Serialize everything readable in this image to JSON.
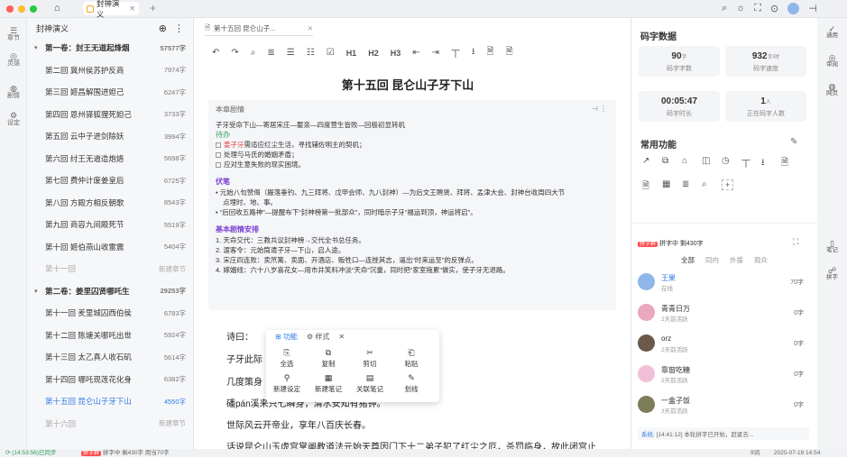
{
  "window": {
    "tab_label": "封神演义",
    "new_tab": "+"
  },
  "topbar_icons": [
    "search-icon",
    "sun-icon",
    "fullscreen-icon",
    "settings-icon",
    "avatar",
    "pin-icon"
  ],
  "leftbar": [
    {
      "label": "章节",
      "glyph": "☰"
    },
    {
      "label": "灵感",
      "glyph": "◎"
    },
    {
      "label": "剧情",
      "glyph": "◍"
    },
    {
      "label": "设定",
      "glyph": "⚙"
    }
  ],
  "outline": {
    "title": "封神演义",
    "add": "⊕",
    "more": "⋮",
    "rows": [
      {
        "name": "第一卷：封王无道起烽烟",
        "count": "57577字",
        "type": "vol"
      },
      {
        "name": "第二回 冀州侯苏护反商",
        "count": "7974字",
        "type": "ch"
      },
      {
        "name": "第三回 姬昌解围进妲己",
        "count": "6247字",
        "type": "ch"
      },
      {
        "name": "第四回 恩州驿狐狸死妲己",
        "count": "3733字",
        "type": "ch"
      },
      {
        "name": "第五回 云中子进剑除妖",
        "count": "3994字",
        "type": "ch"
      },
      {
        "name": "第六回 纣王无道造炮烙",
        "count": "5698字",
        "type": "ch"
      },
      {
        "name": "第七回 费仲计废姜皇后",
        "count": "6725字",
        "type": "ch"
      },
      {
        "name": "第八回 方殿方相反朝歌",
        "count": "8543字",
        "type": "ch"
      },
      {
        "name": "第九回 商容九间殿死节",
        "count": "5519字",
        "type": "ch"
      },
      {
        "name": "第十回 姬伯燕山收雷震",
        "count": "5404字",
        "type": "ch"
      },
      {
        "name": "第十一回",
        "count": "新建章节",
        "type": "new"
      },
      {
        "name": "第二卷：姜里囚贤哪吒生",
        "count": "29253字",
        "type": "vol"
      },
      {
        "name": "第十一回 羑里城囚西伯侯",
        "count": "6783字",
        "type": "ch"
      },
      {
        "name": "第十二回 陈塘关哪吒出世",
        "count": "5924字",
        "type": "ch"
      },
      {
        "name": "第十三回 太乙真人收石矶",
        "count": "5614字",
        "type": "ch"
      },
      {
        "name": "第十四回 哪吒现莲花化身",
        "count": "6382字",
        "type": "ch"
      },
      {
        "name": "第十五回 昆仑山子牙下山",
        "count": "4550字",
        "type": "cur"
      },
      {
        "name": "第十六回",
        "count": "新建章节",
        "type": "new"
      }
    ]
  },
  "editor": {
    "tab_label": "第十五回 昆仑山子...",
    "toolbar": [
      "↶",
      "↷",
      "⌕",
      "≣",
      "☰",
      "☷",
      "☑",
      "H1",
      "H2",
      "H3",
      "⇤",
      "⇥",
      "丅",
      "⭳",
      "🗎",
      "🗎"
    ],
    "chapter_title": "第十五回 昆仑山子牙下山",
    "plot_header": "本章剧情",
    "plot_lines": [
      "子牙受命下山—寄居宋庄—娶亲—四度营生皆败—回极初显转机"
    ],
    "todo_label": "待办",
    "todos": [
      {
        "red": "姜子牙",
        "rest": "需适应红尘生活，寻找辅佐明主的契机；"
      },
      {
        "red": "",
        "rest": "处理与马氏的婚姻矛盾；"
      },
      {
        "red": "",
        "rest": "应对生意失败的现实困境。"
      }
    ],
    "foreshadow_label": "伏笔",
    "foreshadow": [
      "元始八句赞偈（搬落垂钓、九三拜将、戊甲会师、九八封神）—为后文王聘贤、拜将、孟津大会、封神台收周四大节",
      "点埋时、地、事。",
      "“后回收五路神”—提醒布下“封神榜第一批部众”，同时暗示子牙“福运到顶，神运将启”。"
    ],
    "basic_label": "基本剧情安排",
    "basic": [
      "1. 天命交代：三教共议封神榜→交代全书总任务。",
      "2. 渡客令：元始筒遣子牙—下山，启人途。",
      "3. 宋庄四连败：卖笊篱、卖面、开酒店、贩牲口—连挫其志，逼出“时来运至”的反弹点。",
      "4. 嫁姻线：六十八岁喜花女—用市井笑料冲淡“天命”沉重，同时把“家室拖累”做实，使子牙无退路。"
    ],
    "body": [
      "诗曰：",
      "子牙此际",
      "几度策身",
      "磻pán溪来只七瞬身，渭水安知有猪钟。",
      "世际风云开帝业，享年八百庆长春。",
      "话说昆仑山玉虚宫掌阐教道法元始天尊因门下十二弟子犯了红尘之厄，杀罚临身，故此闭宫止"
    ],
    "popup": {
      "tab1": "功能",
      "tab2": "样式",
      "close": "✕",
      "items": [
        {
          "g": "⎘",
          "label": "全选"
        },
        {
          "g": "⧉",
          "label": "复制"
        },
        {
          "g": "✂",
          "label": "剪切"
        },
        {
          "g": "⎗",
          "label": "粘贴"
        },
        {
          "g": "⚲",
          "label": "新建设定"
        },
        {
          "g": "▦",
          "label": "新建笔记"
        },
        {
          "g": "▤",
          "label": "关联笔记"
        },
        {
          "g": "✎",
          "label": "划线"
        }
      ]
    }
  },
  "right": {
    "stats_title": "码字数据",
    "stats": [
      {
        "v": "90",
        "u": "字",
        "l": "码字字数"
      },
      {
        "v": "932",
        "u": "字/时",
        "l": "码字速度"
      },
      {
        "v": "00:05:47",
        "u": "",
        "l": "码字时长"
      },
      {
        "v": "1",
        "u": "人",
        "l": "正在码字人数"
      }
    ],
    "func_title": "常用功能",
    "func_row1": [
      "↗",
      "⧉",
      "⌂",
      "◫",
      "◷",
      "丅",
      "⭳",
      "🗎"
    ],
    "func_row2": [
      "🗎",
      "▦",
      "≣",
      "⌕",
      "+"
    ],
    "chat_badge": "拼字群",
    "chat_status": "拼字中 剩430字",
    "chat_tabs": [
      "全部",
      "同内",
      "外援",
      "观众"
    ],
    "members": [
      {
        "name": "王果",
        "st": "在线",
        "wd": "70字"
      },
      {
        "name": "青青日万",
        "st": "2天前活跃",
        "wd": "0字"
      },
      {
        "name": "orz",
        "st": "2天前活跃",
        "wd": "0字"
      },
      {
        "name": "靠窗吃糖",
        "st": "2天前活跃",
        "wd": "0字"
      },
      {
        "name": "一盒子饭",
        "st": "3天前活跃",
        "wd": "0字"
      }
    ],
    "sys_label": "系统:",
    "sys_msg": "[14:41:12] 本轮拼字已开始，赶紧去..."
  },
  "rightbar": [
    {
      "label": "通用",
      "g": "✓"
    },
    {
      "label": "审阅",
      "g": "◎"
    },
    {
      "label": "网页",
      "g": "◍"
    },
    {
      "label": "笔记",
      "g": "▯"
    },
    {
      "label": "拼字",
      "g": "☍"
    }
  ],
  "statusbar": {
    "sync": "(14:53:56)已同步",
    "badge": "拼字群",
    "info": "拼字中 剩430字 用当70字",
    "words": "9词",
    "date": "2025-07-19 14:54"
  }
}
